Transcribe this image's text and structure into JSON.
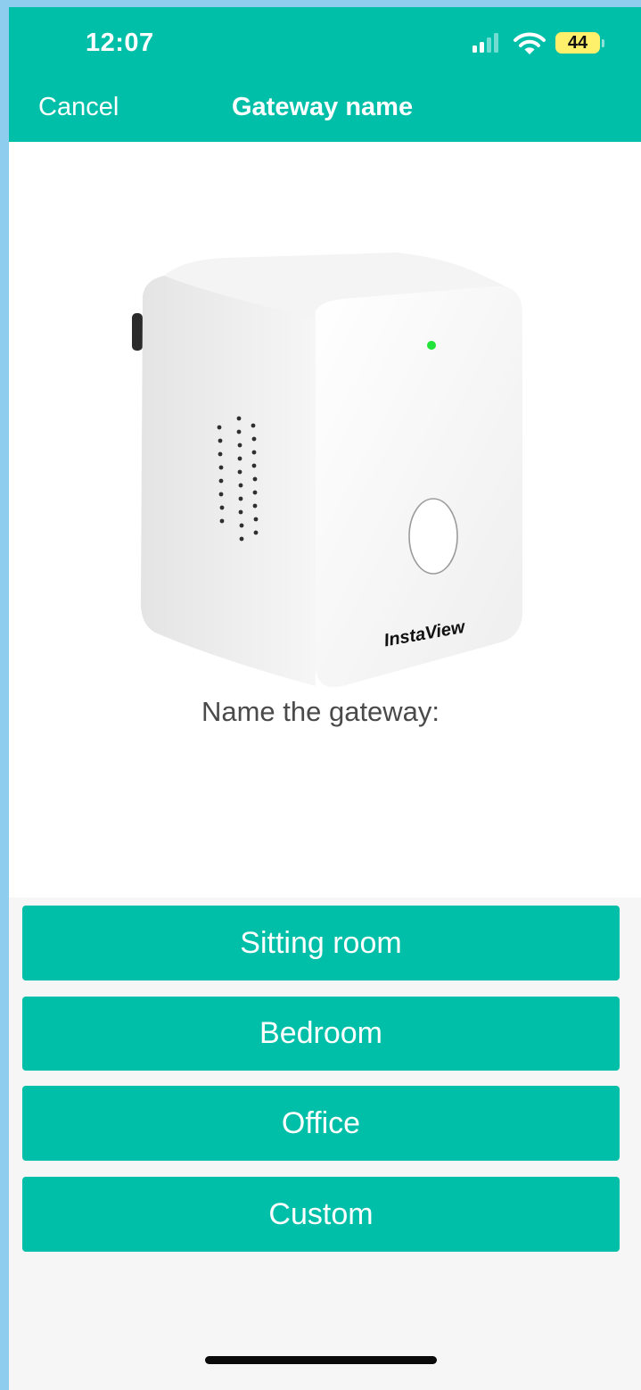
{
  "status_bar": {
    "time": "12:07",
    "battery": "44",
    "signal_icon": "cellular-signal-icon",
    "wifi_icon": "wifi-icon"
  },
  "header": {
    "cancel_label": "Cancel",
    "title": "Gateway name"
  },
  "device_image": {
    "brand_label": "InstaView"
  },
  "prompt": "Name the gateway:",
  "options": [
    {
      "label": "Sitting room"
    },
    {
      "label": "Bedroom"
    },
    {
      "label": "Office"
    },
    {
      "label": "Custom"
    }
  ],
  "colors": {
    "accent": "#00bfa9",
    "battery": "#fff06c",
    "background": "#f6f6f6",
    "led": "#22e33a"
  }
}
